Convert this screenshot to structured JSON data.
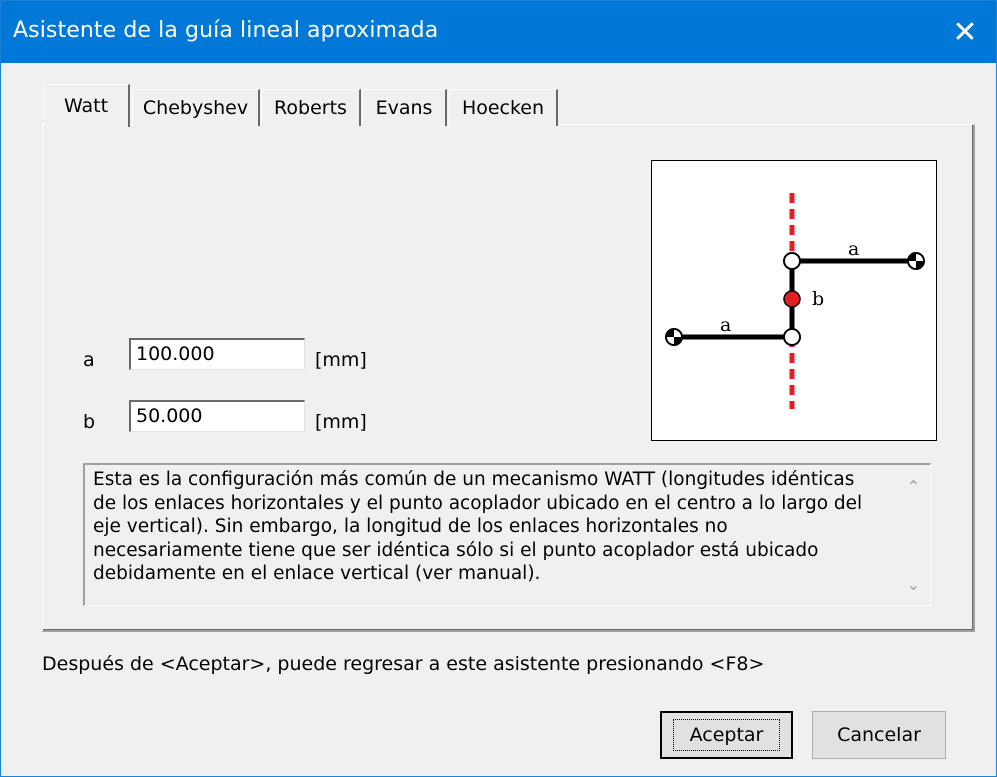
{
  "window": {
    "title": "Asistente de la guía lineal aproximada",
    "close_glyph": "✕"
  },
  "tabs": [
    {
      "label": "Watt",
      "active": true
    },
    {
      "label": "Chebyshev",
      "active": false
    },
    {
      "label": "Roberts",
      "active": false
    },
    {
      "label": "Evans",
      "active": false
    },
    {
      "label": "Hoecken",
      "active": false
    }
  ],
  "params": {
    "a": {
      "label": "a",
      "value": "100.000",
      "unit": "[mm]"
    },
    "b": {
      "label": "b",
      "value": "50.000",
      "unit": "[mm]"
    }
  },
  "diagram": {
    "label_a": "a",
    "label_b": "b",
    "colors": {
      "guide": "#e02020",
      "link": "#000000",
      "coupler": "#e02020"
    }
  },
  "description": "Esta es la configuración más común de un mecanismo WATT (longitudes idénticas\nde los enlaces horizontales y el punto acoplador ubicado en el centro a lo largo del\neje vertical). Sin embargo, la longitud de los enlaces horizontales no\nnecesariamente tiene que ser idéntica sólo si el punto acoplador está ubicado\ndebidamente en el enlace vertical (ver manual).",
  "hint": "Después de <Aceptar>, puede regresar a este asistente presionando <F8>",
  "buttons": {
    "ok": "Aceptar",
    "cancel": "Cancelar"
  },
  "icons": {
    "scroll_up": "chevron-up-icon",
    "scroll_down": "chevron-down-icon"
  }
}
